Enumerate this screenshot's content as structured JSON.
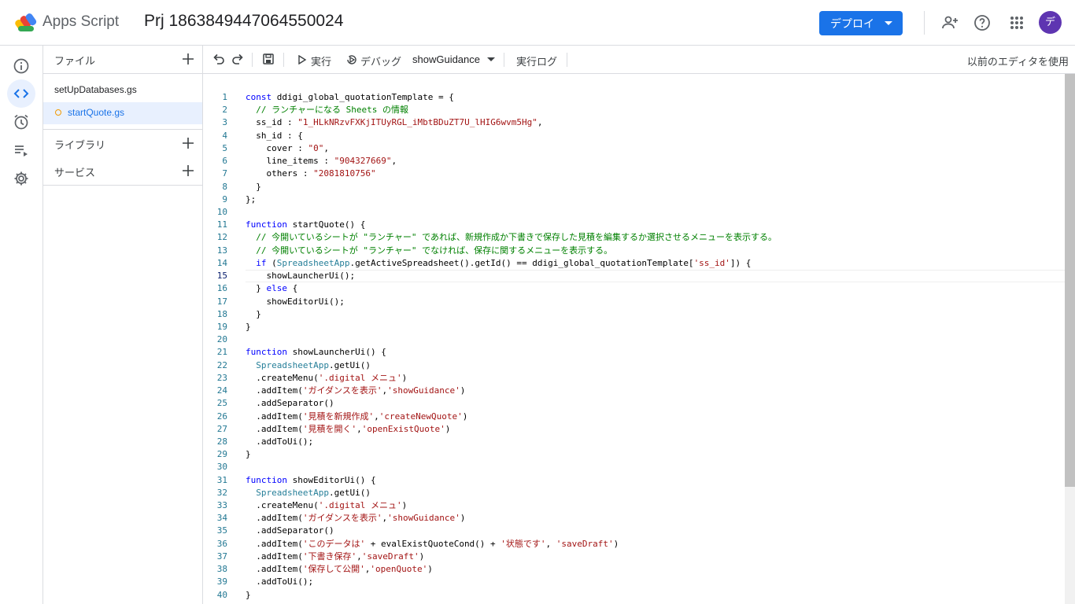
{
  "header": {
    "app_name": "Apps Script",
    "project_name": "Prj 1863849447064550024",
    "deploy_label": "デプロイ",
    "avatar_initial": "デ"
  },
  "rail": {
    "items": [
      "info-icon",
      "code-icon",
      "clock-icon",
      "run-list-icon",
      "settings-icon"
    ],
    "active": "code-icon"
  },
  "files_panel": {
    "files_header": "ファイル",
    "files": [
      {
        "name": "setUpDatabases.gs"
      },
      {
        "name": "startQuote.gs"
      }
    ],
    "active_file": "startQuote.gs",
    "libraries_header": "ライブラリ",
    "services_header": "サービス"
  },
  "toolbar": {
    "run_label": "実行",
    "debug_label": "デバッグ",
    "function_select": "showGuidance",
    "exec_log_label": "実行ログ",
    "previous_editor_link": "以前のエディタを使用"
  },
  "editor": {
    "current_line": 15,
    "lines": [
      "const ddigi_global_quotationTemplate = {",
      "  // ランチャーになる Sheets の情報",
      "  ss_id : \"1_HLkNRzvFXKjITUyRGL_iMbtBDuZT7U_lHIG6wvm5Hg\",",
      "  sh_id : {",
      "    cover : \"0\",",
      "    line_items : \"904327669\",",
      "    others : \"2081810756\"",
      "  }",
      "};",
      "",
      "function startQuote() {",
      "  // 今開いているシートが \"ランチャー\" であれば、新規作成か下書きで保存した見積を編集するか選択させるメニューを表示する。",
      "  // 今開いているシートが \"ランチャー\" でなければ、保存に関するメニューを表示する。",
      "  if (SpreadsheetApp.getActiveSpreadsheet().getId() == ddigi_global_quotationTemplate['ss_id']) {",
      "    showLauncherUi();",
      "  } else {",
      "    showEditorUi();",
      "  }",
      "}",
      "",
      "function showLauncherUi() {",
      "  SpreadsheetApp.getUi()",
      "  .createMenu('.digital メニュ')",
      "  .addItem('ガイダンスを表示','showGuidance')",
      "  .addSeparator()",
      "  .addItem('見積を新規作成','createNewQuote')",
      "  .addItem('見積を開く','openExistQuote')",
      "  .addToUi();",
      "}",
      "",
      "function showEditorUi() {",
      "  SpreadsheetApp.getUi()",
      "  .createMenu('.digital メニュ')",
      "  .addItem('ガイダンスを表示','showGuidance')",
      "  .addSeparator()",
      "  .addItem('このデータは' + evalExistQuoteCond() + '状態です', 'saveDraft')",
      "  .addItem('下書き保存','saveDraft')",
      "  .addItem('保存して公開','openQuote')",
      "  .addToUi();",
      "}"
    ]
  }
}
